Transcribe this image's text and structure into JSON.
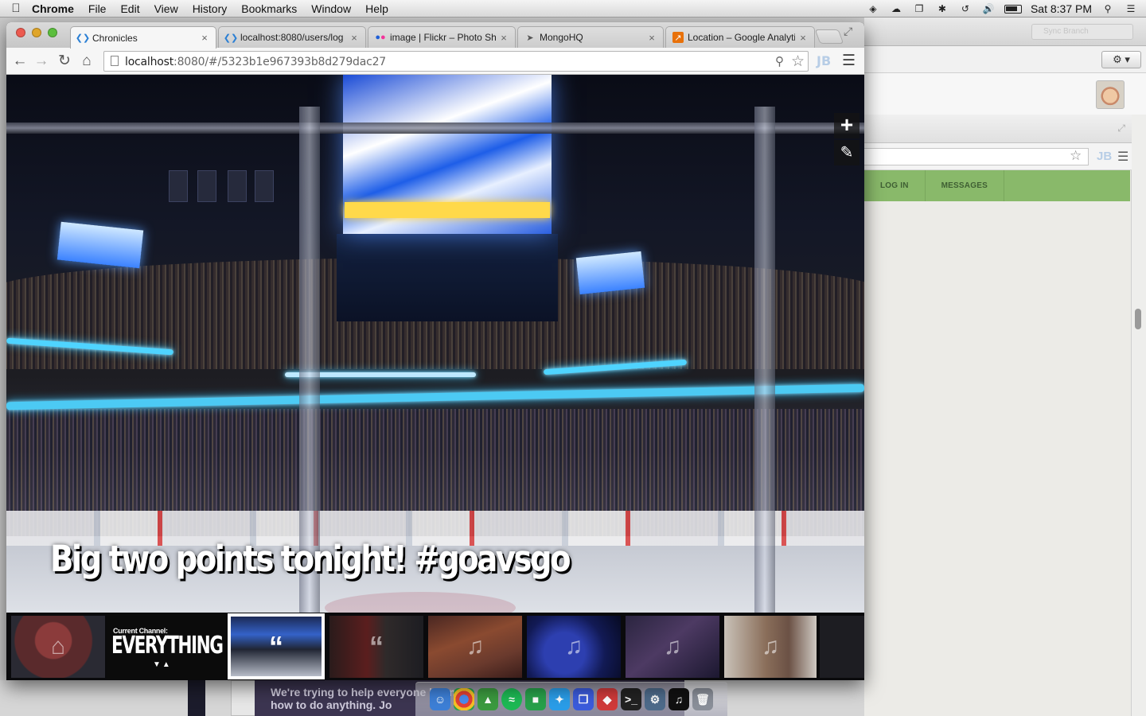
{
  "menubar": {
    "app_name": "Chrome",
    "menus": [
      "File",
      "Edit",
      "View",
      "History",
      "Bookmarks",
      "Window",
      "Help"
    ],
    "clock": "Sat 8:37 PM"
  },
  "browser": {
    "tabs": [
      {
        "title": "Chronicles",
        "favicon": "chronicles-icon",
        "active": true
      },
      {
        "title": "localhost:8080/users/log",
        "favicon": "chronicles-icon",
        "active": false
      },
      {
        "title": "image | Flickr – Photo Sh",
        "favicon": "flickr-icon",
        "active": false
      },
      {
        "title": "MongoHQ",
        "favicon": "mongohq-icon",
        "active": false
      },
      {
        "title": "Location – Google Analyti",
        "favicon": "analytics-icon",
        "active": false
      }
    ],
    "url_host": "localhost",
    "url_rest": ":8080/#/5323b1e967393b8d279dac27",
    "extension_label": "JB"
  },
  "photo": {
    "caption": "Big two points tonight! #goavsgo",
    "add_label": "+",
    "edit_icon": "edit-icon"
  },
  "channel": {
    "subtitle": "Current Channel:",
    "name": "EVERYTHING",
    "arrows": "▼▲"
  },
  "thumbnails": [
    {
      "kind": "home",
      "icon": "home-icon"
    },
    {
      "kind": "quote",
      "icon": "quote-icon",
      "selected": true
    },
    {
      "kind": "quote",
      "icon": "quote-icon"
    },
    {
      "kind": "music",
      "icon": "music-note-icon"
    },
    {
      "kind": "music",
      "icon": "music-note-icon"
    },
    {
      "kind": "music",
      "icon": "music-note-icon"
    },
    {
      "kind": "music",
      "icon": "music-note-icon"
    }
  ],
  "background_window": {
    "sync_branch_label": "Sync Branch",
    "gear_label": "⚙ ▾",
    "nav_items": [
      "LOG IN",
      "MESSAGES"
    ],
    "extension_label": "JB"
  },
  "behind_window": {
    "text": "We're trying to help everyone learn how to do anything. Jo"
  }
}
